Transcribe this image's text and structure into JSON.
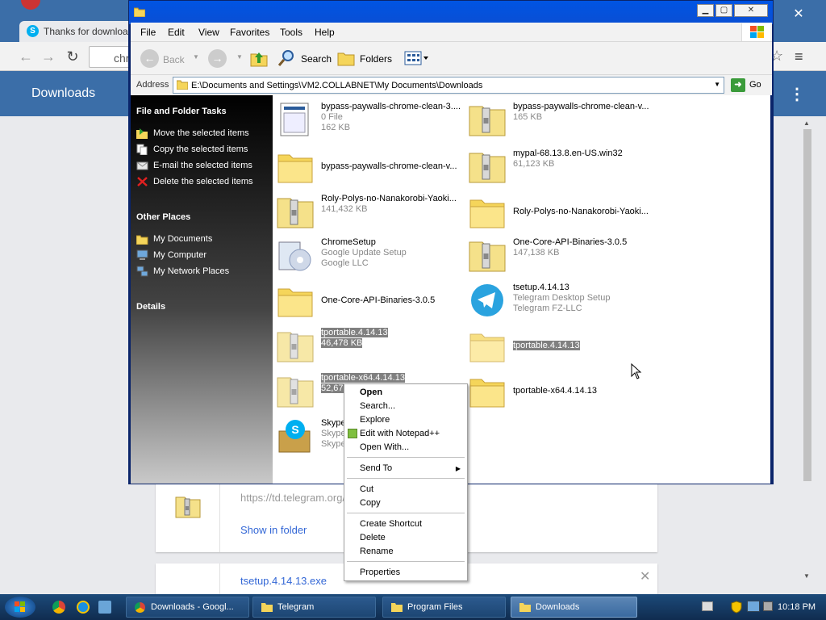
{
  "chrome": {
    "tab_title": "Thanks for downloa",
    "omnibox_text": "chr",
    "page_title": "Downloads",
    "card1": {
      "url": "https://td.telegram.org/",
      "show_in_folder": "Show in folder"
    },
    "card2": {
      "filename": "tsetup.4.14.13.exe"
    }
  },
  "explorer": {
    "menu": [
      "File",
      "Edit",
      "View",
      "Favorites",
      "Tools",
      "Help"
    ],
    "toolbar": {
      "back": "Back",
      "search": "Search",
      "folders": "Folders"
    },
    "address_label": "Address",
    "address_path": "E:\\Documents and Settings\\VM2.COLLABNET\\My Documents\\Downloads",
    "go_label": "Go",
    "file_tasks_title": "File and Folder Tasks",
    "file_tasks": [
      {
        "label": "Move the selected items",
        "icon": "move-icon"
      },
      {
        "label": "Copy the selected items",
        "icon": "copy-icon"
      },
      {
        "label": "E-mail the selected items",
        "icon": "email-icon"
      },
      {
        "label": "Delete the selected items",
        "icon": "delete-icon"
      }
    ],
    "other_places_title": "Other Places",
    "other_places": [
      {
        "label": "My Documents",
        "icon": "folder-icon"
      },
      {
        "label": "My Computer",
        "icon": "computer-icon"
      },
      {
        "label": "My Network Places",
        "icon": "network-icon"
      }
    ],
    "details_title": "Details",
    "items": [
      {
        "name": "bypass-paywalls-chrome-clean-3....",
        "sub1": "0 File",
        "sub2": "162 KB",
        "icon": "generic-file-icon"
      },
      {
        "name": "bypass-paywalls-chrome-clean-v...",
        "sub1": "165 KB",
        "sub2": "",
        "icon": "zip-folder-icon"
      },
      {
        "name": "bypass-paywalls-chrome-clean-v...",
        "sub1": "",
        "sub2": "",
        "icon": "folder-icon"
      },
      {
        "name": "mypal-68.13.8.en-US.win32",
        "sub1": "61,123 KB",
        "sub2": "",
        "icon": "zip-folder-icon"
      },
      {
        "name": "Roly-Polys-no-Nanakorobi-Yaoki...",
        "sub1": "141,432 KB",
        "sub2": "",
        "icon": "zip-folder-icon"
      },
      {
        "name": "Roly-Polys-no-Nanakorobi-Yaoki...",
        "sub1": "",
        "sub2": "",
        "icon": "folder-icon"
      },
      {
        "name": "ChromeSetup",
        "sub1": "Google Update Setup",
        "sub2": "Google LLC",
        "icon": "installer-icon"
      },
      {
        "name": "One-Core-API-Binaries-3.0.5",
        "sub1": "147,138 KB",
        "sub2": "",
        "icon": "zip-folder-icon"
      },
      {
        "name": "One-Core-API-Binaries-3.0.5",
        "sub1": "",
        "sub2": "",
        "icon": "folder-icon"
      },
      {
        "name": "tsetup.4.14.13",
        "sub1": "Telegram Desktop Setup",
        "sub2": "Telegram FZ-LLC",
        "icon": "telegram-icon"
      },
      {
        "name": "tportable.4.14.13",
        "sub1": "46,478 KB",
        "sub2": "",
        "icon": "zip-folder-icon"
      },
      {
        "name": "tportable.4.14.13",
        "sub1": "",
        "sub2": "",
        "icon": "folder-icon"
      },
      {
        "name": "tportable-x64.4.14.13",
        "sub1": "52,673 KB",
        "sub2": "",
        "icon": "zip-folder-icon"
      },
      {
        "name": "tportable-x64.4.14.13",
        "sub1": "",
        "sub2": "",
        "icon": "folder-icon"
      },
      {
        "name": "Skype",
        "sub1": "Skype",
        "sub2": "Skype",
        "icon": "skype-icon"
      }
    ]
  },
  "context_menu": {
    "open": "Open",
    "search": "Search...",
    "explore": "Explore",
    "edit_npp": "Edit with Notepad++",
    "open_with": "Open With...",
    "send_to": "Send To",
    "cut": "Cut",
    "copy": "Copy",
    "create_shortcut": "Create Shortcut",
    "delete": "Delete",
    "rename": "Rename",
    "properties": "Properties"
  },
  "taskbar": {
    "buttons": [
      {
        "label": "Downloads - Googl...",
        "icon": "chrome-icon"
      },
      {
        "label": "Telegram",
        "icon": "folder-icon"
      },
      {
        "label": "Program Files",
        "icon": "folder-icon"
      },
      {
        "label": "Downloads",
        "icon": "folder-icon"
      }
    ],
    "time": "10:18 PM"
  },
  "colors": {
    "selection": "#808080",
    "link": "#3367d6",
    "header_blue": "#3b6ea8"
  }
}
